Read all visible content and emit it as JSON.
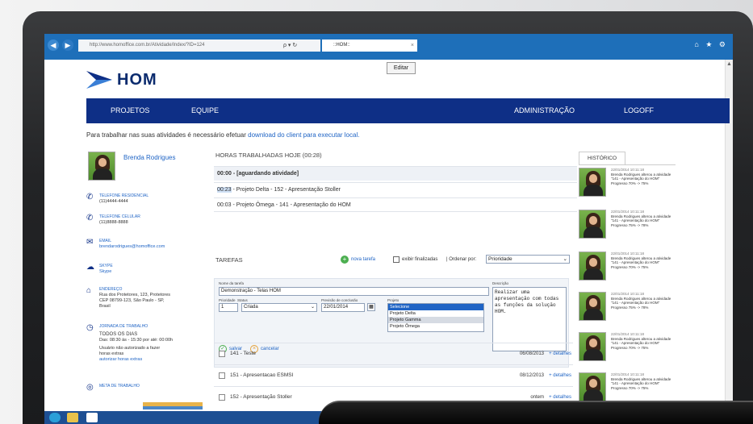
{
  "browser": {
    "address": "http://www.homoffice.com.br/Atividade/Index/?ID=124",
    "address_ctrl": "ρ ▾ ↻",
    "tab_label": "::HOM::",
    "tab_close": "×",
    "window_icons": "⌂ ★ ⚙",
    "editar": "Editar"
  },
  "logo": {
    "text": "HOM"
  },
  "menu": {
    "projetos": "PROJETOS",
    "equipe": "EQUIPE",
    "administracao": "ADMINISTRAÇÃO",
    "logoff": "LOGOFF"
  },
  "notice": {
    "text": "Para trabalhar nas suas atividades é necessário efetuar",
    "link": "download do client para executar local."
  },
  "profile": {
    "name": "Brenda Rodrigues",
    "telefone_residencial_title": "TELEFONE RESIDENCIAL",
    "telefone_residencial": "(11)4444-4444",
    "telefone_celular_title": "TELEFONE CELULAR",
    "telefone_celular": "(11)8888-8888",
    "email_title": "EMAIL",
    "email": "brendarodrigues@homoffice.com",
    "skype_title": "SKYPE",
    "skype": "Skype",
    "endereco_title": "ENDEREÇO",
    "endereco": "Rua dos Protetores, 123, Protetores\nCEP 08799-123, São Paulo - SP,\nBrasil",
    "jornada_title": "JORNADA DE TRABALHO",
    "jornada_days": "TODOS OS DIAS",
    "jornada_hours": "Das: 08:30 às - 15:30 por até: 00:00h",
    "jornada_note": "Usuário não autorizado a fazer horas extras",
    "jornada_link": "autorizar horas extras",
    "meta_title": "META DE TRABALHO"
  },
  "horas": {
    "title": "HORAS TRABALHADAS HOJE (00:28)",
    "rows": [
      "00:00 - [aguardando atividade]",
      "00:23 - Projeto Delta - 152 - Apresentação Stoller",
      "00:03 - Projeto Ômega - 141 - Apresentação do HOM"
    ],
    "row2_time": "00:23",
    "row2_rest": " - Projeto Delta - 152 - Apresentação Stoller"
  },
  "tarefas": {
    "title": "TAREFAS",
    "nova": "nova tarefa",
    "exibir": "exibir finalizadas",
    "ordenar": "| Ordenar por:",
    "ordenar_value": "Prioridade"
  },
  "form": {
    "nome_label": "Nome da tarefa",
    "nome_value": "Demonstração - Telas HOM",
    "prioridade_label": "Prioridade",
    "status_label": "Status",
    "prioridade_value": "1",
    "status_value": "Criada",
    "previsao_label": "Previsão de conclusão",
    "previsao_value": "22/01/2014",
    "projeto_label": "Projeto",
    "projetos": [
      "Selecione",
      "Projeto Delta",
      "Projeto Gamma",
      "Projeto Ômega"
    ],
    "descricao_label": "Descrição",
    "descricao_value": "Realizar uma apresentação com todas as funções da solução HOM.",
    "salvar": "salvar",
    "cancelar": "cancelar"
  },
  "tasks": [
    {
      "name": "141 - Teste",
      "date": "06/08/2013",
      "det": "+ detalhes"
    },
    {
      "name": "151 - Apresentacao ESMSI",
      "date": "08/12/2013",
      "det": "+ detalhes"
    },
    {
      "name": "152 - Apresentação Stoller",
      "date": "ontem",
      "det": "+ detalhes"
    }
  ],
  "historico": {
    "tab": "HISTÓRICO",
    "items": [
      {
        "date": "22/01/2014 10:11:18",
        "text": "Brenda Rodrigues alterou a atividade \"141 - Apresentação do HOM\" Progresso 70% -> 75%"
      },
      {
        "date": "22/01/2014 10:11:18",
        "text": "Brenda Rodrigues alterou a atividade \"141 - Apresentação do HOM\" Progresso 75% -> 78%"
      },
      {
        "date": "22/01/2014 10:11:18",
        "text": "Brenda Rodrigues alterou a atividade \"141 - Apresentação do HOM\" Progresso 70% -> 75%"
      },
      {
        "date": "22/01/2014 10:11:18",
        "text": "Brenda Rodrigues alterou a atividade \"141 - Apresentação do HOM\" Progresso 75% -> 78%"
      },
      {
        "date": "22/01/2014 10:11:18",
        "text": "Brenda Rodrigues alterou a atividade \"141 - Apresentação do HOM\" Progresso 70% -> 75%"
      },
      {
        "date": "22/01/2014 10:11:18",
        "text": "Brenda Rodrigues alterou a atividade \"141 - Apresentação do HOM\" Progresso 70% -> 75%"
      }
    ]
  },
  "colors": {
    "accent": "#0e2f86",
    "link": "#1f64c5",
    "chrome": "#1e6fb9"
  }
}
